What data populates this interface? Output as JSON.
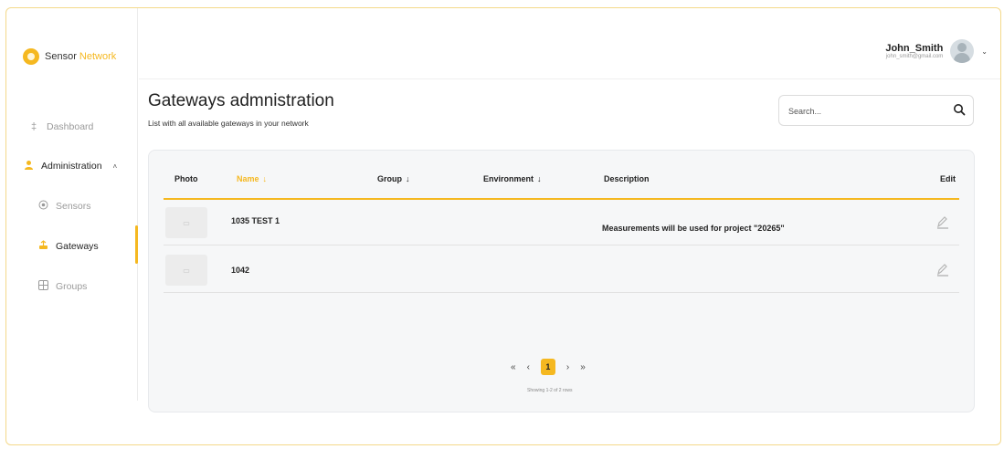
{
  "brand": {
    "name_part1": "Sensor",
    "name_part2": "Network"
  },
  "sidebar": {
    "items": [
      {
        "label": "Dashboard",
        "icon": "gauge-icon"
      },
      {
        "label": "Administration",
        "icon": "admin-icon"
      },
      {
        "label": "Sensors",
        "icon": "sensor-icon"
      },
      {
        "label": "Gateways",
        "icon": "gateway-icon"
      },
      {
        "label": "Groups",
        "icon": "grid-icon"
      }
    ]
  },
  "user": {
    "name": "John_Smith",
    "email": "john_smith@gmail.com"
  },
  "page": {
    "title": "Gateways admnistration",
    "subtitle": "List with all available gateways in your network"
  },
  "search": {
    "placeholder": "Search..."
  },
  "table": {
    "columns": {
      "photo": "Photo",
      "name": "Name",
      "group": "Group",
      "environment": "Environment",
      "description": "Description",
      "edit": "Edit"
    },
    "rows": [
      {
        "name": "1035 TEST 1",
        "group": "",
        "environment": "",
        "description": "Measurements will be used for project \"20265\""
      },
      {
        "name": "1042",
        "group": "",
        "environment": "",
        "description": ""
      }
    ]
  },
  "pagination": {
    "first": "«",
    "prev": "‹",
    "current_page": "1",
    "next": "›",
    "last": "»",
    "showing": "Showing 1-2 of 2 rows"
  },
  "colors": {
    "accent": "#f5b820",
    "card_bg": "#f6f7f8",
    "border": "#e7e9ec"
  }
}
